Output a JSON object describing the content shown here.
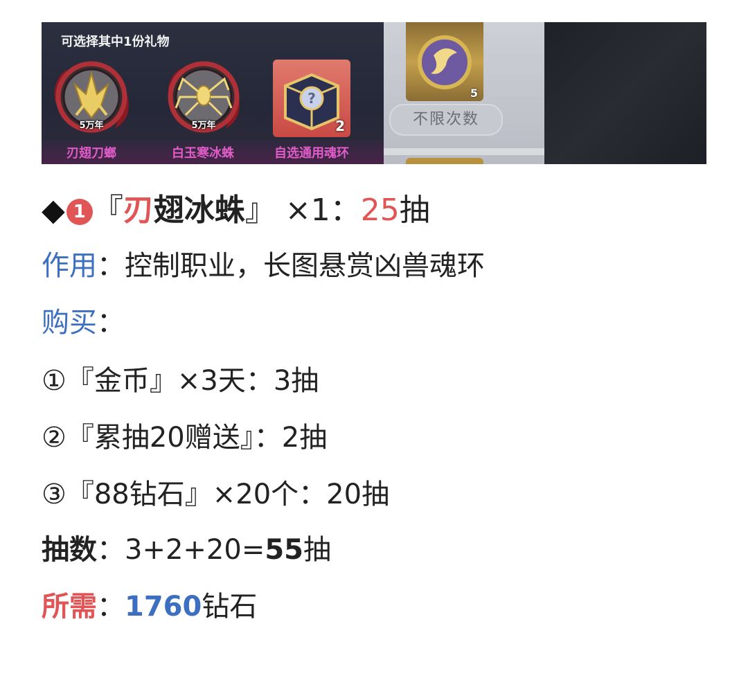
{
  "banner": {
    "gift_title": "可选择其中1份礼物",
    "items": [
      {
        "name": "刃翅刀螂",
        "age": "5万年"
      },
      {
        "name": "白玉寒冰蛛",
        "age": "5万年"
      },
      {
        "name": "自选通用魂环",
        "count": "2"
      }
    ],
    "side_card_count": "5",
    "unlimited_label": "不限次数"
  },
  "heading": {
    "bullet": "◆",
    "badge": "1",
    "open_bracket": "『",
    "name_first": "刃",
    "name_rest": "翅冰蛛",
    "close_bracket": "』",
    "qty": " ×1：",
    "pulls_num": "25",
    "pulls_unit": "抽"
  },
  "usage": {
    "label": "作用",
    "sep": "：",
    "text": "控制职业，长图悬赏凶兽魂环"
  },
  "purchase": {
    "label": "购买",
    "sep": "："
  },
  "options": [
    "①『金币』×3天：3抽",
    "②『累抽20赠送』：2抽",
    "③『88钻石』×20个：20抽"
  ],
  "total": {
    "label": "抽数",
    "sep": "：",
    "expr": "3+2+20=",
    "value": "55",
    "unit": "抽"
  },
  "cost": {
    "label": "所需",
    "sep": "：",
    "value": "1760",
    "unit": "钻石"
  },
  "colors": {
    "accent_red": "#e05555",
    "accent_blue": "#3d6fc0",
    "item_pink": "#e05cc8"
  }
}
